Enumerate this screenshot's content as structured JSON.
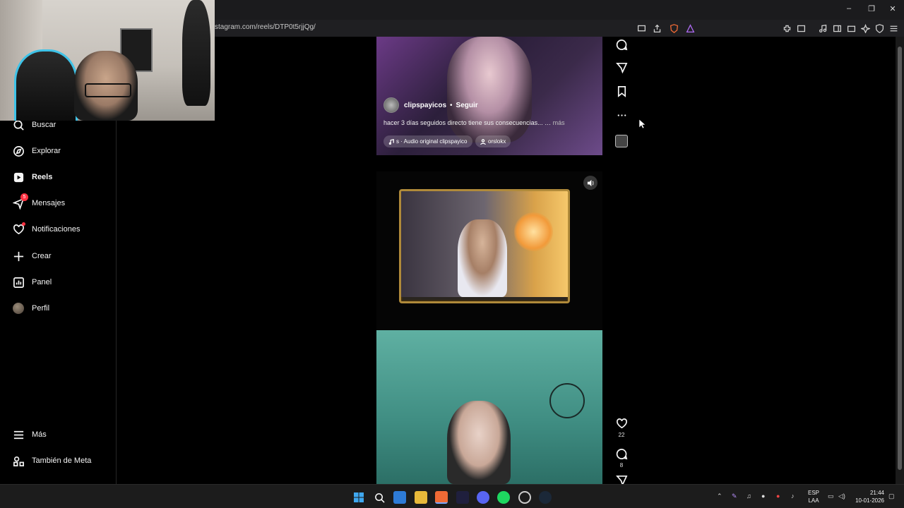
{
  "browser": {
    "url": "stagram.com/reels/DTP0t5rjjQg/",
    "window_controls": [
      "–",
      "❐",
      "✕"
    ]
  },
  "sidebar": {
    "items": [
      {
        "label": "Buscar",
        "icon": "search-icon"
      },
      {
        "label": "Explorar",
        "icon": "compass-icon"
      },
      {
        "label": "Reels",
        "icon": "reels-icon",
        "active": true
      },
      {
        "label": "Mensajes",
        "icon": "messenger-icon",
        "badge": "5"
      },
      {
        "label": "Notificaciones",
        "icon": "heart-icon",
        "dot": true
      },
      {
        "label": "Crear",
        "icon": "plus-icon"
      },
      {
        "label": "Panel",
        "icon": "chart-icon"
      },
      {
        "label": "Perfil",
        "icon": "avatar"
      }
    ],
    "bottom_items": [
      {
        "label": "Más",
        "icon": "menu-icon"
      },
      {
        "label": "También de Meta",
        "icon": "meta-apps-icon"
      }
    ]
  },
  "reel1": {
    "author": "clipspayicos",
    "separator": "•",
    "follow_label": "Seguir",
    "caption": "hacer 3 días seguidos directo tiene sus consecuencias... …",
    "more_label": "más",
    "audio_chip": "s · Audio original  clipspayico",
    "user_chip": "orslokx"
  },
  "reel3_actions": {
    "likes": "22",
    "comments": "8"
  },
  "taskbar": {
    "lang_top": "ESP",
    "lang_bottom": "LAA",
    "time": "21:44",
    "date": "10-01-2026"
  },
  "colors": {
    "background": "#000000",
    "badge": "#ff3040",
    "frame_gold": "#b08a3a"
  }
}
